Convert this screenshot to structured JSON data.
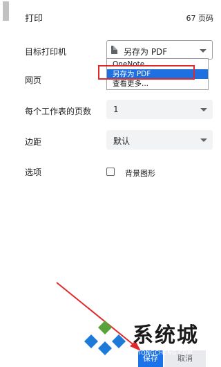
{
  "header": {
    "title": "打印",
    "page_count": "67 页码"
  },
  "rows": {
    "printer_label": "目标打印机",
    "pages_label": "网页",
    "pages_per_sheet_label": "每个工作表的页数",
    "margins_label": "边距",
    "options_label": "选项"
  },
  "printer_select": {
    "value": "另存为 PDF"
  },
  "printer_dropdown": {
    "items": [
      {
        "label": "OneNote",
        "selected": false
      },
      {
        "label": "另存为 PDF",
        "selected": true
      },
      {
        "label": "查看更多...",
        "selected": false
      }
    ]
  },
  "pages_per_sheet_select": {
    "value": "1"
  },
  "margins_select": {
    "value": "默认"
  },
  "options": {
    "background_graphics_label": "背景图形",
    "background_graphics_checked": false
  },
  "buttons": {
    "save_label": "保存",
    "cancel_label": "取消"
  },
  "watermark": {
    "text": "系统城",
    "subtext": "XITONGCHENG.COM"
  },
  "colors": {
    "accent": "#1a73e8",
    "highlight": "#e0282a",
    "selected_item": "#1e6fe0"
  }
}
